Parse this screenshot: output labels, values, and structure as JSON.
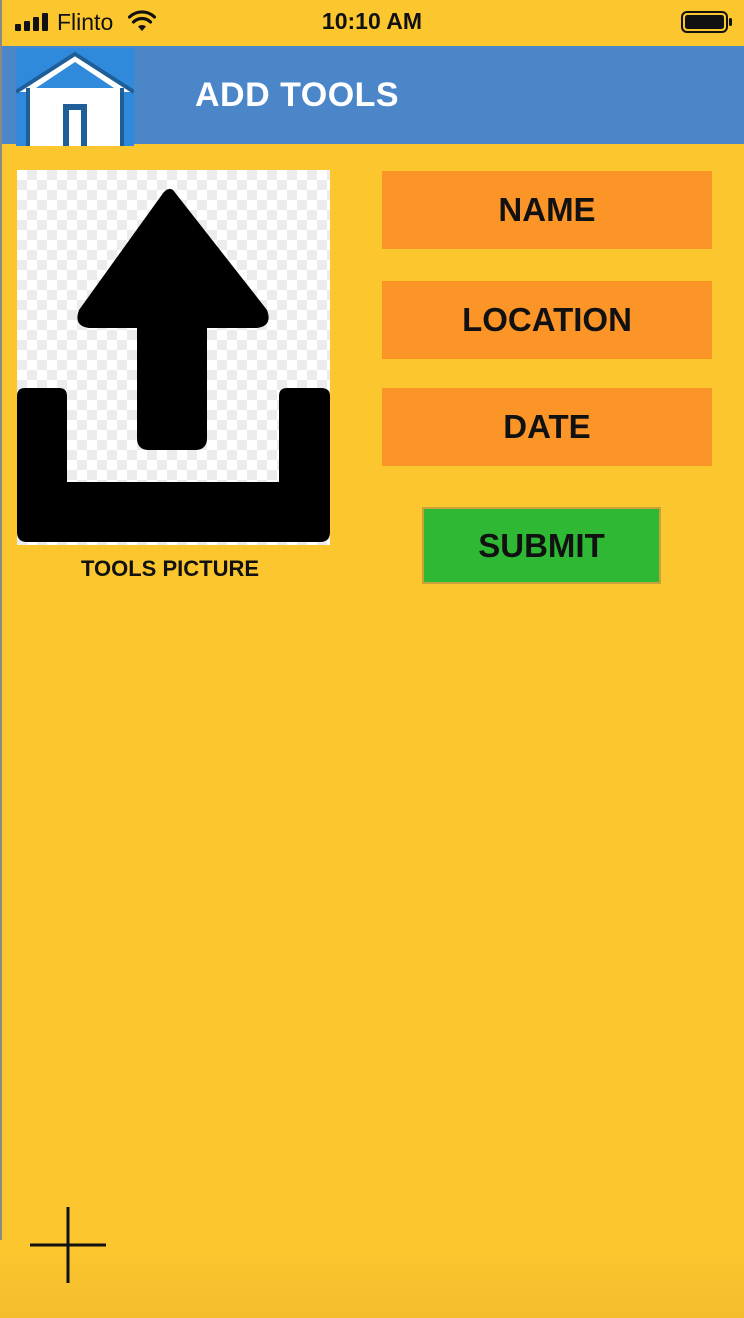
{
  "status_bar": {
    "carrier": "Flinto",
    "time": "10:10 AM",
    "icons": [
      "signal-icon",
      "wifi-icon",
      "battery-icon"
    ]
  },
  "header": {
    "title": "ADD TOOLS",
    "home_icon": "home-icon"
  },
  "picture": {
    "label": "TOOLS PICTURE",
    "icon": "upload-icon"
  },
  "form": {
    "name_label": "NAME",
    "location_label": "LOCATION",
    "date_label": "DATE",
    "submit_label": "SUBMIT"
  },
  "footer": {
    "add_icon": "plus-icon"
  },
  "colors": {
    "background": "#FCC72E",
    "header": "#4A86C8",
    "field": "#FC9528",
    "submit": "#2FB834"
  }
}
